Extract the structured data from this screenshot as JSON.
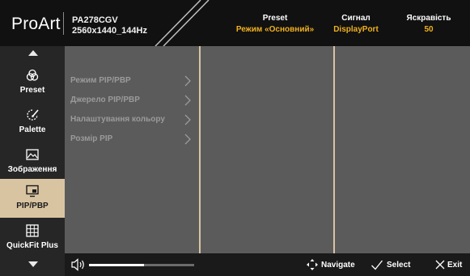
{
  "header": {
    "brand": "ProArt",
    "model_line1": "PA278CGV",
    "model_line2": "2560x1440_144Hz",
    "columns": [
      {
        "title": "Preset",
        "value": "Режим «Основний»"
      },
      {
        "title": "Сигнал",
        "value": "DisplayPort"
      },
      {
        "title": "Яскравість",
        "value": "50"
      }
    ]
  },
  "sidebar": {
    "items": [
      {
        "label": "Preset",
        "icon": "preset-icon"
      },
      {
        "label": "Palette",
        "icon": "palette-icon"
      },
      {
        "label": "Зображення",
        "icon": "image-icon"
      },
      {
        "label": "PIP/PBP",
        "icon": "pip-pbp-icon",
        "active": true
      },
      {
        "label": "QuickFit Plus",
        "icon": "grid-icon"
      }
    ]
  },
  "submenu": {
    "items": [
      {
        "label": "Режим PIP/PBP"
      },
      {
        "label": "Джерело PIP/PBP"
      },
      {
        "label": "Налаштування кольору"
      },
      {
        "label": "Розмір PIP"
      }
    ]
  },
  "footer": {
    "volume_level": 0.52,
    "navigate": "Navigate",
    "select": "Select",
    "exit": "Exit"
  },
  "colors": {
    "accent": "#d9c4a2",
    "value_text": "#f0b020",
    "panel": "#5b5b5b"
  }
}
